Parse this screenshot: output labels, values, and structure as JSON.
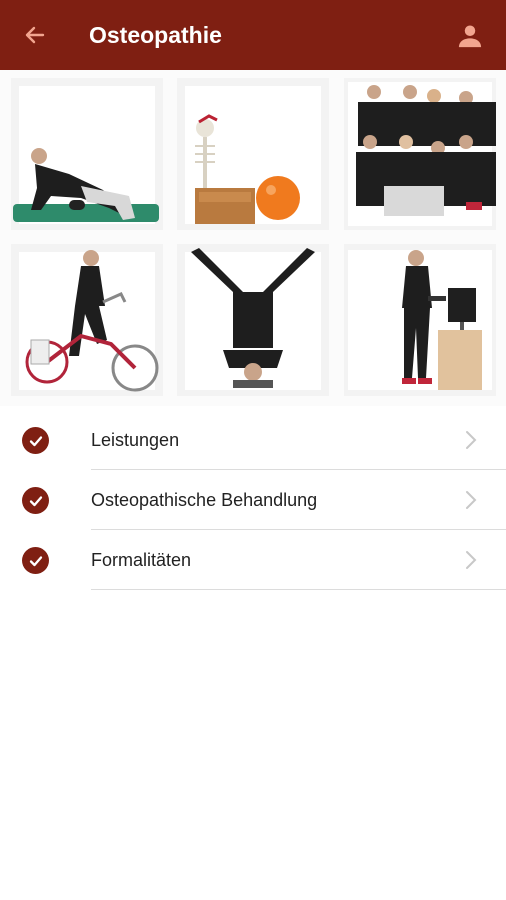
{
  "header": {
    "title": "Osteopathie",
    "back_icon": "arrow-left-icon",
    "user_icon": "user-icon",
    "background_color": "#7f1f12"
  },
  "gallery": {
    "tiles": [
      {
        "icon": "photo"
      },
      {
        "icon": "photo"
      },
      {
        "icon": "photo"
      },
      {
        "icon": "photo"
      },
      {
        "icon": "photo"
      },
      {
        "icon": "photo"
      }
    ]
  },
  "menu": {
    "accent_color": "#7f1f12",
    "items": [
      {
        "label": "Leistungen",
        "icon": "check-circle-icon"
      },
      {
        "label": "Osteopathische Behandlung",
        "icon": "check-circle-icon"
      },
      {
        "label": "Formalitäten",
        "icon": "check-circle-icon"
      }
    ]
  }
}
